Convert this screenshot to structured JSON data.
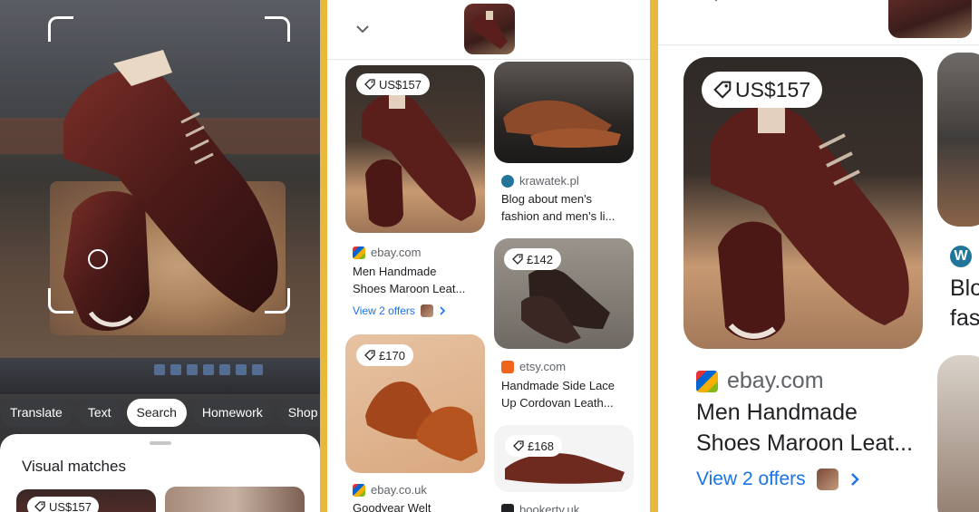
{
  "camera": {
    "chips": [
      "Translate",
      "Text",
      "Search",
      "Homework",
      "Shop"
    ],
    "active_chip": "Search",
    "sheet_title": "Visual matches",
    "first_price": "US$157"
  },
  "results": {
    "cards": [
      {
        "price": "US$157",
        "source": "ebay.com",
        "title_line1": "Men Handmade",
        "title_line2": "Shoes Maroon Leat...",
        "offers": "View 2 offers"
      },
      {
        "price": "",
        "source": "krawatek.pl",
        "title_line1": "Blog about men's",
        "title_line2": "fashion and men's li...",
        "offers": ""
      },
      {
        "price": "£142",
        "source": "etsy.com",
        "title_line1": "Handmade Side Lace",
        "title_line2": "Up Cordovan Leath...",
        "offers": ""
      },
      {
        "price": "£170",
        "source": "ebay.co.uk",
        "title_line1": "Goodyear Welt",
        "title_line2": "",
        "offers": ""
      },
      {
        "price": "£168",
        "source": "bookerty.uk",
        "title_line1": "",
        "title_line2": "",
        "offers": ""
      }
    ]
  },
  "detail": {
    "price": "US$157",
    "source": "ebay.com",
    "title_line1": "Men Handmade",
    "title_line2": "Shoes Maroon Leat...",
    "offers": "View 2 offers",
    "side_text_line1": "Blo",
    "side_text_line2": "fas"
  },
  "colors": {
    "link_blue": "#1a73e8",
    "divider_gold": "#e8b93a",
    "chip_dark": "#3a3b3e"
  }
}
